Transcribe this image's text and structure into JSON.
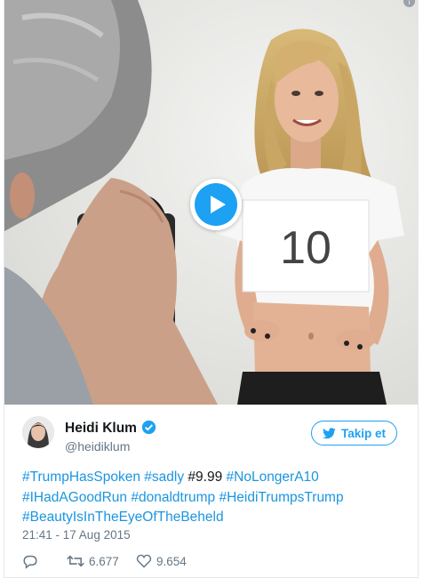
{
  "media": {
    "type": "video",
    "sign_text": "10",
    "info_icon": "info-icon",
    "play_icon": "play-icon"
  },
  "user": {
    "name": "Heidi Klum",
    "handle": "@heidiklum",
    "verified_icon": "verified-badge-icon"
  },
  "follow_button": {
    "label": "Takip et",
    "icon": "twitter-bird-icon"
  },
  "tweet": {
    "tags": {
      "trump_has_spoken": "#TrumpHasSpoken",
      "sadly": "#sadly",
      "nine_nine_nine": "#9.99",
      "no_longer_a10": "#NoLongerA10",
      "i_had_a_good_run": "#IHadAGoodRun",
      "donaldtrump": "#donaldtrump",
      "heidi_trumps_trump": "#HeidiTrumpsTrump",
      "beauty": "#BeautyIsInTheEyeOfTheBeheld"
    }
  },
  "timestamp": "21:41 - 17 Aug 2015",
  "actions": {
    "reply_icon": "reply-icon",
    "retweet_icon": "retweet-icon",
    "retweet_count": "6.677",
    "like_icon": "heart-icon",
    "like_count": "9.654"
  },
  "colors": {
    "accent": "#1da1f2",
    "link": "#1b95e0",
    "muted": "#657786"
  }
}
